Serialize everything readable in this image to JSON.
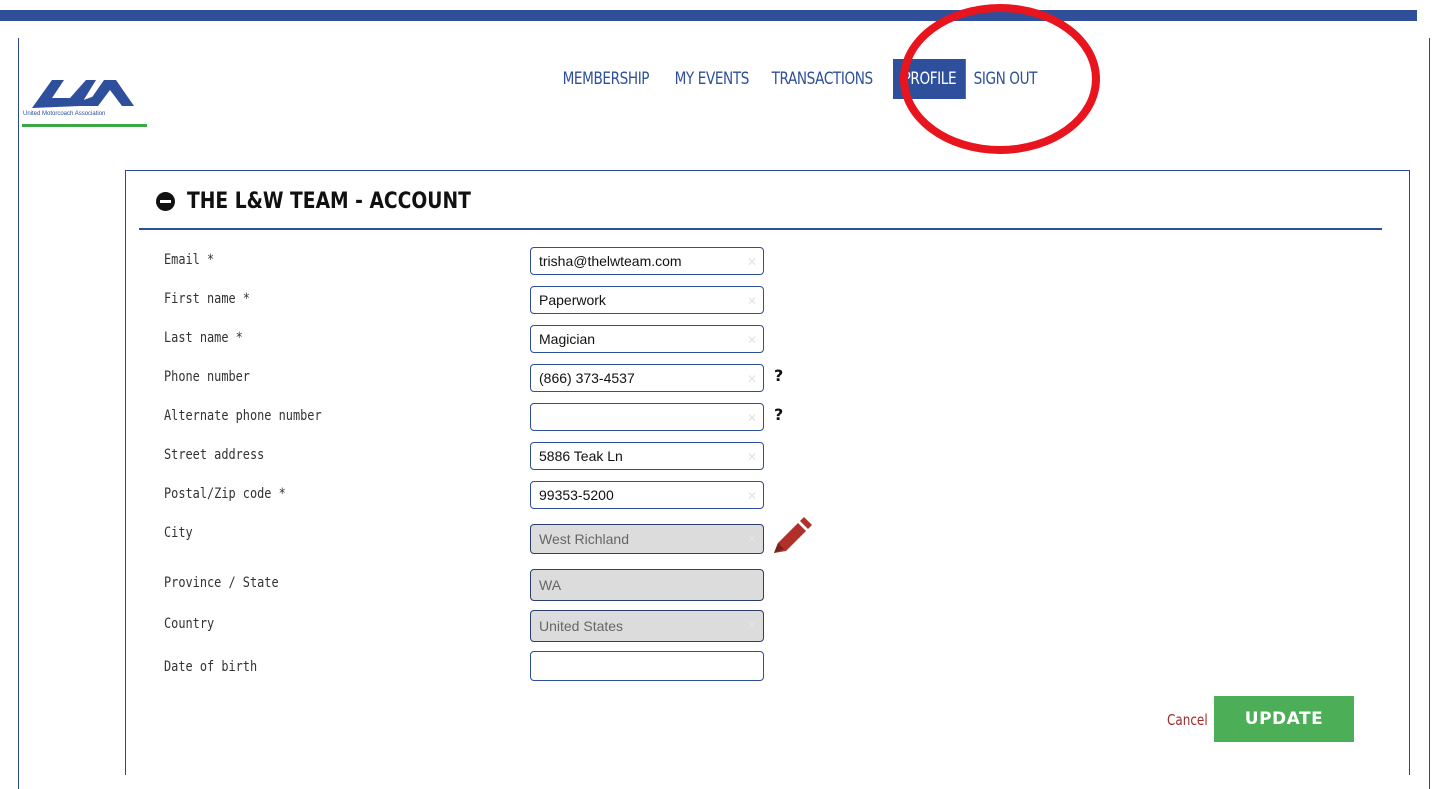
{
  "logo": {
    "brand_text": "United Motorcoach Association"
  },
  "nav": {
    "items": [
      {
        "label": "MEMBERSHIP"
      },
      {
        "label": "MY EVENTS"
      },
      {
        "label": "TRANSACTIONS"
      },
      {
        "label": "PROFILE",
        "active": true
      },
      {
        "label": "SIGN OUT"
      }
    ]
  },
  "panel": {
    "title": "THE L&W TEAM - ACCOUNT",
    "fields": [
      {
        "label": "Email *",
        "value": "trisha@thelwteam.com"
      },
      {
        "label": "First name *",
        "value": "Paperwork"
      },
      {
        "label": "Last name *",
        "value": "Magician"
      },
      {
        "label": "Phone number",
        "value": "(866) 373-4537",
        "help": "?"
      },
      {
        "label": "Alternate phone number",
        "value": "",
        "help": "?"
      },
      {
        "label": "Street address",
        "value": "5886 Teak Ln"
      },
      {
        "label": "Postal/Zip code *",
        "value": "99353-5200"
      },
      {
        "label": "City",
        "value": "West Richland",
        "readonly": true
      },
      {
        "label": "Province / State",
        "value": "WA",
        "readonly": true
      },
      {
        "label": "Country",
        "value": "United States",
        "readonly": true
      },
      {
        "label": "Date of birth",
        "value": ""
      }
    ],
    "cancel_label": "Cancel",
    "update_label": "UPDATE"
  },
  "colors": {
    "brand_blue": "#2d4f9c",
    "update_green": "#4cae56",
    "cancel_red": "#9b2a2a",
    "annotation_red": "#e8141e"
  }
}
